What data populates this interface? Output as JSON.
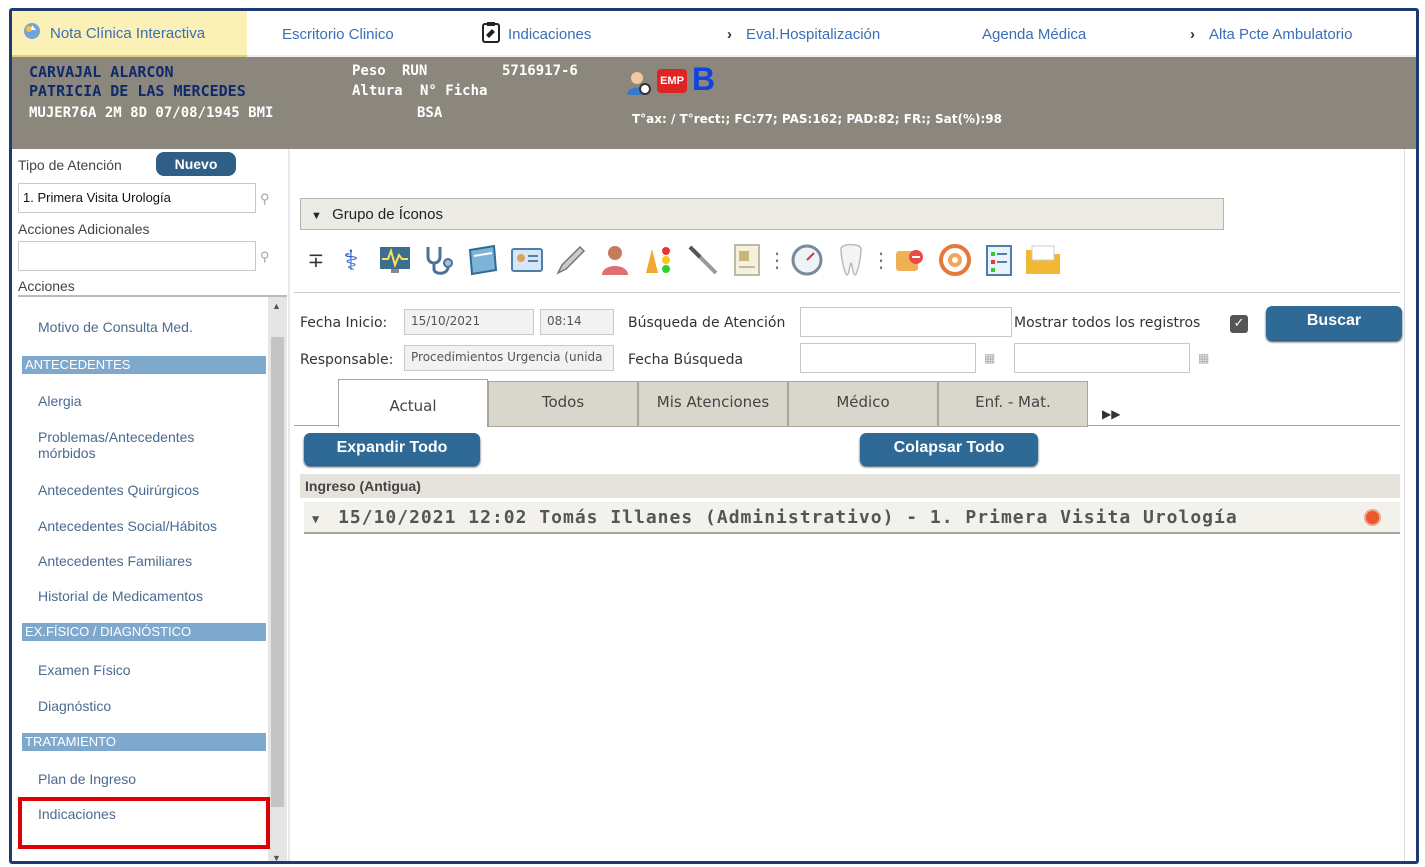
{
  "nav": {
    "items": [
      {
        "label": "Nota Clínica Interactiva",
        "icon": "nota-clinica-icon"
      },
      {
        "label": "Escritorio Clinico"
      },
      {
        "label": "Indicaciones",
        "icon": "clipboard-icon"
      },
      {
        "label": "Eval.Hospitalización",
        "icon": "chevron-right-icon"
      },
      {
        "label": "Agenda Médica"
      },
      {
        "label": "Alta Pcte Ambulatorio",
        "icon": "chevron-right-icon"
      }
    ]
  },
  "patient": {
    "surname": "CARVAJAL ALARCON",
    "given": "PATRICIA DE LAS MERCEDES",
    "demographics": "MUJER76A 2M 8D 07/08/1945 BMI",
    "peso_label": "Peso",
    "run_label": "RUN",
    "run_value": "5716917-6",
    "altura_label": "Altura",
    "ficha_label": "N° Ficha",
    "bsa_label": "BSA",
    "emp_badge": "EMP",
    "b_badge": "B",
    "vitals": "T°ax: / T°rect:; FC:77; PAS:162; PAD:82; FR:; Sat(%):98"
  },
  "sidebar": {
    "tipo_label": "Tipo de Atención",
    "nuevo_label": "Nuevo",
    "tipo_value": "1. Primera Visita Urología",
    "acciones_adicionales_label": "Acciones Adicionales",
    "acciones_adicionales_value": "",
    "acciones_label": "Acciones",
    "items": {
      "motivo": "Motivo de Consulta Med.",
      "sec_antecedentes": "ANTECEDENTES",
      "alergia": "Alergia",
      "problemas1": "Problemas/Antecedentes",
      "problemas2": "mórbidos",
      "quirurgicos": "Antecedentes Quirúrgicos",
      "social": "Antecedentes Social/Hábitos",
      "familiares": "Antecedentes Familiares",
      "medicamentos": "Historial de Medicamentos",
      "sec_exfisico": "EX.FÍSICO / DIAGNÓSTICO",
      "examen": "Examen Físico",
      "diagnostico": "Diagnóstico",
      "sec_tratamiento": "TRATAMIENTO",
      "plan": "Plan de Ingreso",
      "indicaciones": "Indicaciones"
    }
  },
  "main": {
    "group_label": "Grupo de Íconos",
    "icons": [
      "plus-minus-icon",
      "caduceus-icon",
      "monitor-icon",
      "stethoscope-icon",
      "notebook-icon",
      "id-card-icon",
      "pencil-icon",
      "doctor-icon",
      "traffic-icon",
      "scalpel-icon",
      "document-icon",
      "gauge-icon",
      "tooth-icon",
      "pills-icon",
      "target-icon",
      "checklist-icon",
      "folder-icon"
    ],
    "fecha_inicio_label": "Fecha Inicio:",
    "fecha_inicio_value": "15/10/2021",
    "hora_value": "08:14",
    "busqueda_atencion_label": "Búsqueda de Atención",
    "busqueda_atencion_value": "",
    "mostrar_label": "Mostrar todos los registros",
    "buscar_label": "Buscar",
    "responsable_label": "Responsable:",
    "responsable_value": "Procedimientos Urgencia (unida",
    "fecha_busqueda_label": "Fecha Búsqueda",
    "fecha_busqueda_desde": "",
    "fecha_busqueda_hasta": "",
    "tabs": [
      "Actual",
      "Todos",
      "Mis Atenciones",
      "Médico",
      "Enf. - Mat."
    ],
    "tabs_more": "▶▶",
    "expandir_label": "Expandir Todo",
    "colapsar_label": "Colapsar Todo",
    "ingreso_label": "Ingreso (Antigua)",
    "entry_text": "15/10/2021 12:02 Tomás Illanes (Administrativo) - 1. Primera Visita Urología"
  }
}
